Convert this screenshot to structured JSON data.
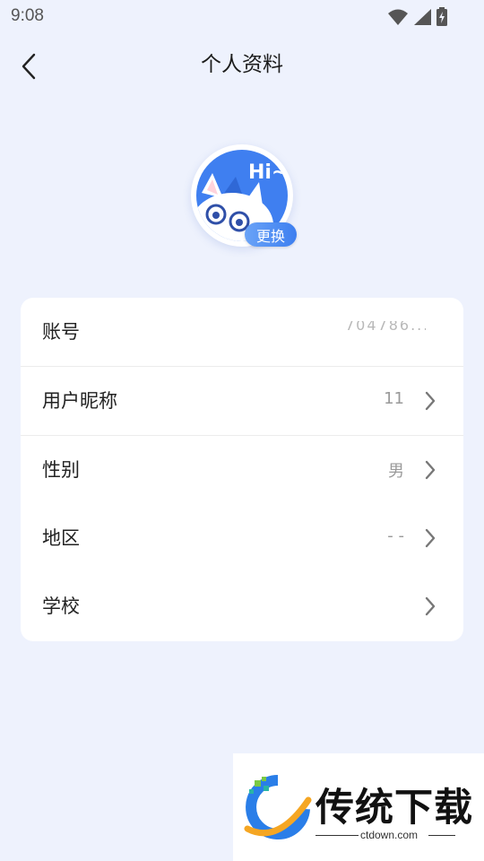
{
  "status_bar": {
    "time": "9:08",
    "icons": [
      "wifi-icon",
      "cellular-signal-icon",
      "battery-charging-icon"
    ]
  },
  "header": {
    "title": "个人资料",
    "back_icon": "chevron-left-icon"
  },
  "avatar": {
    "image_text": "Hi~",
    "change_label": "更换"
  },
  "profile_rows": [
    {
      "label": "账号",
      "value": "704786..."
    },
    {
      "label": "用户昵称",
      "value": "11"
    },
    {
      "label": "性别",
      "value": "男"
    },
    {
      "label": "地区",
      "value": "- -"
    },
    {
      "label": "学校",
      "value": ""
    }
  ],
  "watermark": {
    "title": "传统下载",
    "url": "ctdown.com"
  },
  "colors": {
    "background": "#eef2fd",
    "accent": "#3d7ff0",
    "card": "#ffffff",
    "value_text": "#9a9a9a"
  }
}
